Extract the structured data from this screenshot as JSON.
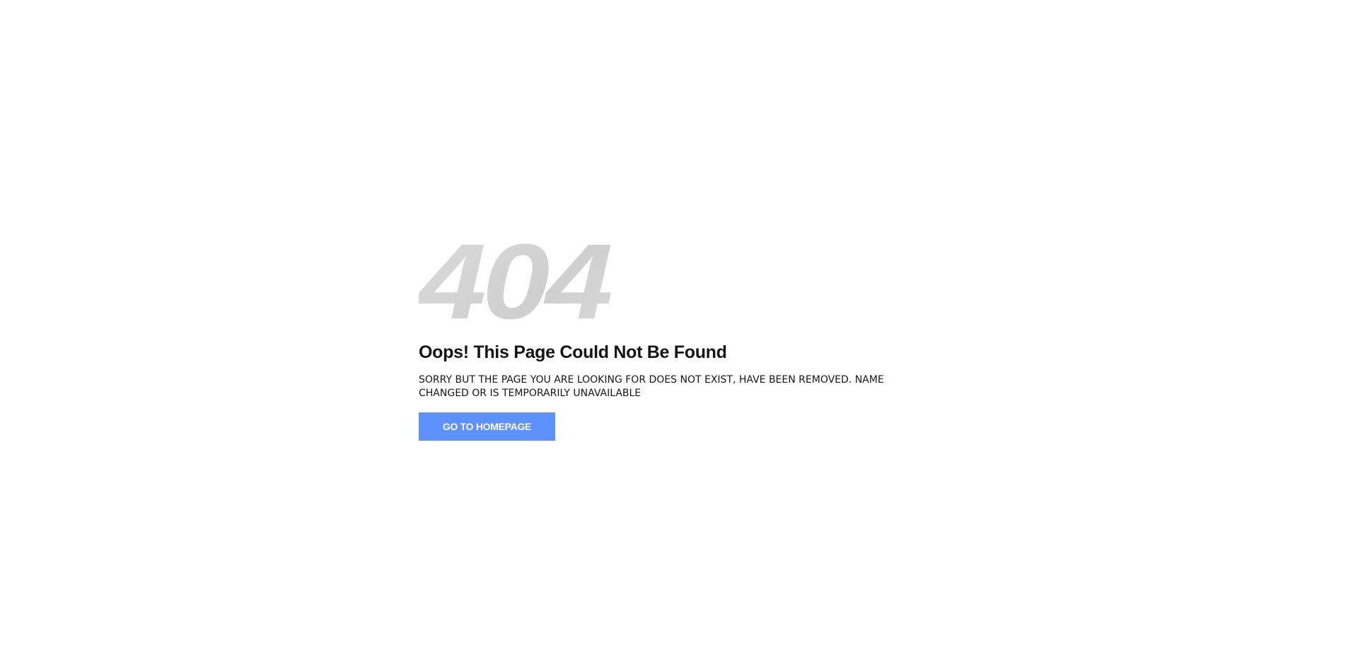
{
  "notfound": {
    "code": "404",
    "title": "Oops! This Page Could Not Be Found",
    "description": "SORRY BUT THE PAGE YOU ARE LOOKING FOR DOES NOT EXIST, HAVE BEEN REMOVED. NAME CHANGED OR IS TEMPORARILY UNAVAILABLE",
    "button_label": "GO TO HOMEPAGE"
  },
  "colors": {
    "background": "#ffffff",
    "code_gray": "#d3d3d3",
    "text": "#151515",
    "button": "#5c91fe",
    "button_text": "#ffffff"
  }
}
